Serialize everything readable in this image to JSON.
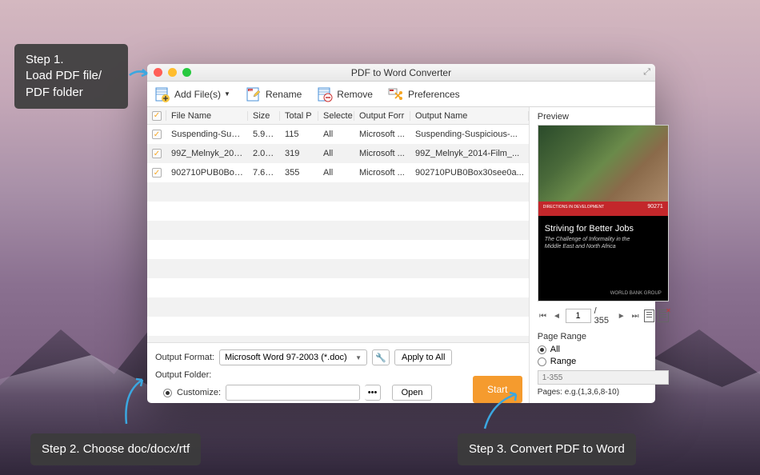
{
  "window": {
    "title": "PDF to Word Converter"
  },
  "toolbar": {
    "add_files": "Add File(s)",
    "rename": "Rename",
    "remove": "Remove",
    "preferences": "Preferences"
  },
  "table": {
    "headers": {
      "filename": "File Name",
      "size": "Size",
      "total": "Total P",
      "selected": "Selecte",
      "format": "Output Forr",
      "output": "Output Name"
    },
    "rows": [
      {
        "checked": true,
        "name": "Suspending-Suspici...",
        "size": "5.97 ...",
        "total": "115",
        "selected": "All",
        "format": "Microsoft ...",
        "output": "Suspending-Suspicious-..."
      },
      {
        "checked": true,
        "name": "99Z_Melnyk_2014-...",
        "size": "2.08 ...",
        "total": "319",
        "selected": "All",
        "format": "Microsoft ...",
        "output": "99Z_Melnyk_2014-Film_..."
      },
      {
        "checked": true,
        "name": "902710PUB0Box30...",
        "size": "7.61 ...",
        "total": "355",
        "selected": "All",
        "format": "Microsoft ...",
        "output": "902710PUB0Box30see0a..."
      }
    ]
  },
  "footer": {
    "output_format_label": "Output Format:",
    "output_format_value": "Microsoft Word 97-2003 (*.doc)",
    "apply_all": "Apply to All",
    "output_folder_label": "Output Folder:",
    "customize": "Customize:",
    "open": "Open",
    "start": "Start"
  },
  "preview": {
    "label": "Preview",
    "book_title": "Striving for Better Jobs",
    "book_subtitle1": "The Challenge of Informality in the",
    "book_subtitle2": "Middle East and North Africa",
    "book_footer": "WORLD BANK GROUP",
    "book_redlabel": "DIRECTIONS IN DEVELOPMENT",
    "book_code": "90271",
    "page_current": "1",
    "page_total": "/ 355",
    "range_label": "Page Range",
    "range_all": "All",
    "range_range": "Range",
    "range_placeholder": "1-355",
    "pages_hint": "Pages: e.g.(1,3,6,8-10)"
  },
  "callouts": {
    "step1": "Step 1.\nLoad PDF file/\nPDF folder",
    "step2": "Step 2. Choose doc/docx/rtf",
    "step3": "Step 3. Convert PDF to Word"
  }
}
